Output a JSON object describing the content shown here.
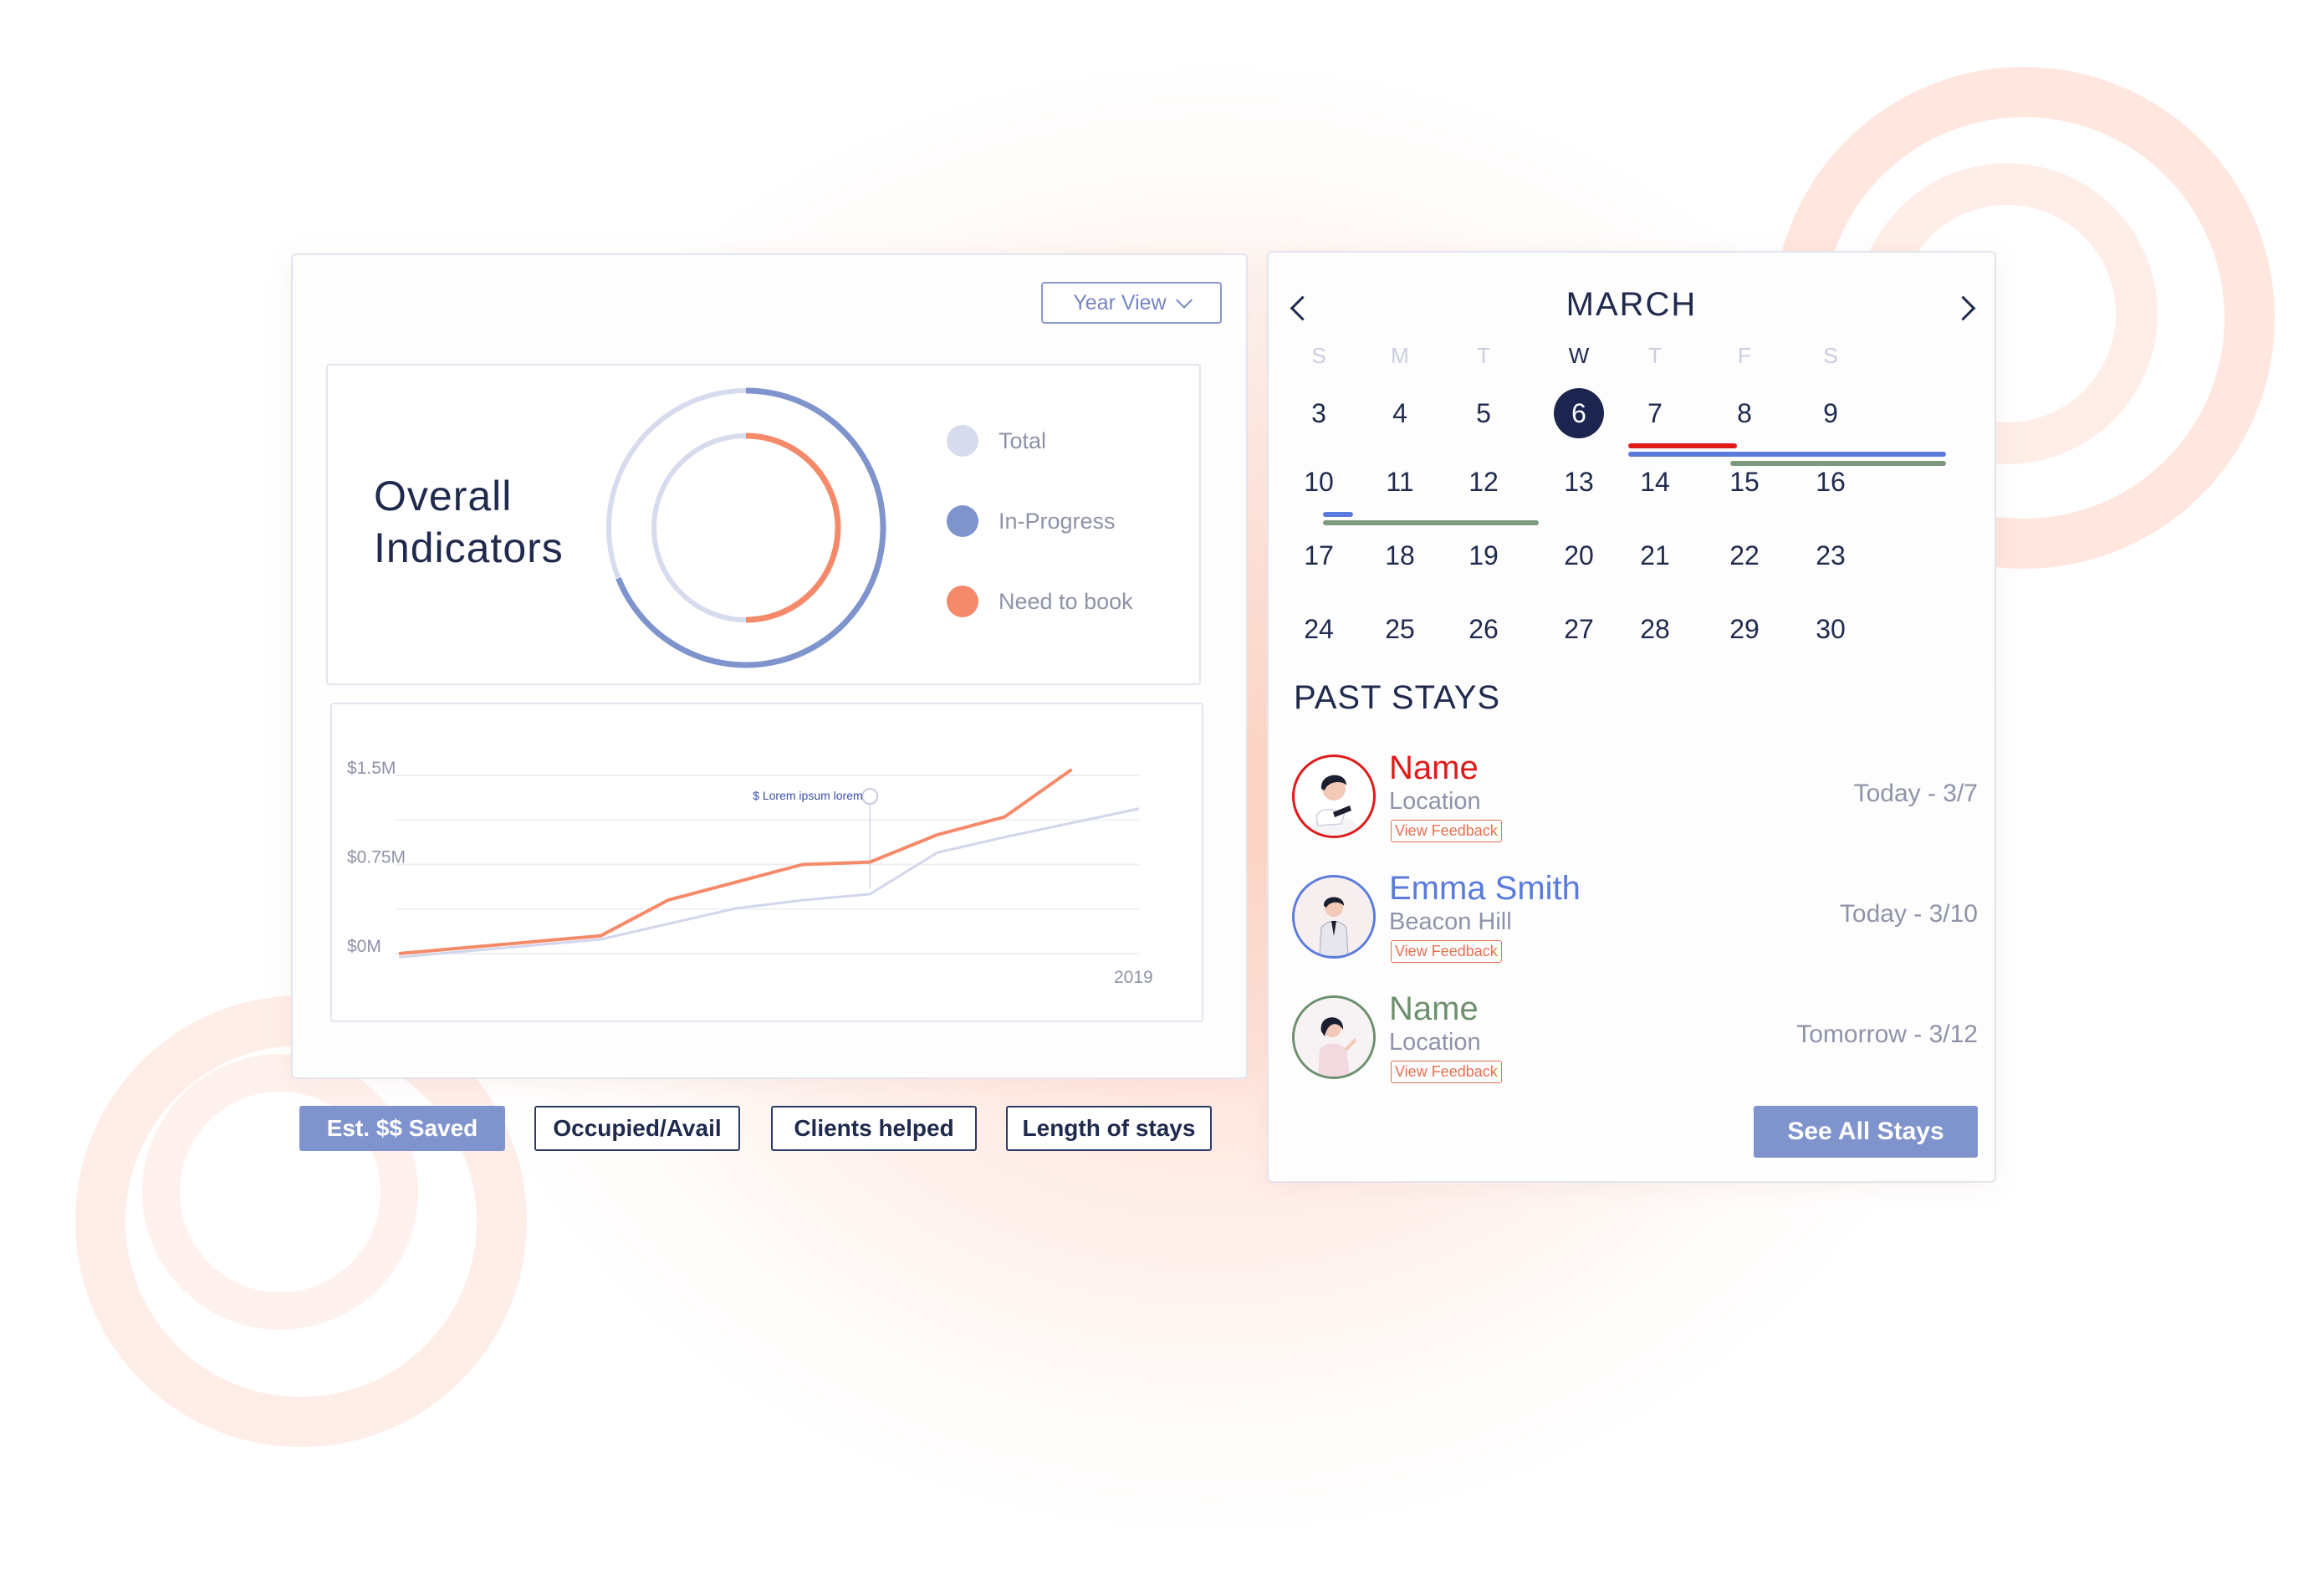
{
  "dashboard": {
    "year_view": "Year View",
    "indicators": {
      "title_line1": "Overall",
      "title_line2": "Indicators",
      "legend": [
        {
          "label": "Total",
          "color": "#d6dcee"
        },
        {
          "label": "In-Progress",
          "color": "#7f93cd"
        },
        {
          "label": "Need to book",
          "color": "#f58a6a"
        }
      ],
      "donut": {
        "outer_fraction": 0.69,
        "inner_fraction": 0.5
      }
    },
    "tabs": [
      {
        "label": "Est. $$ Saved",
        "active": true
      },
      {
        "label": "Occupied/Avail",
        "active": false
      },
      {
        "label": "Clients helped",
        "active": false
      },
      {
        "label": "Length of stays",
        "active": false
      }
    ]
  },
  "chart_data": {
    "type": "line",
    "ytick_labels": [
      "$1.5M",
      "$0.75M",
      "$0M"
    ],
    "yticks": [
      1.5,
      0.75,
      0
    ],
    "ylim": [
      0,
      1.5
    ],
    "x": [
      0,
      1,
      2,
      3,
      4,
      5,
      6,
      7,
      8,
      9,
      10,
      11
    ],
    "x_label_right": "2019",
    "annotation": "$ Lorem ipsum lorem",
    "series": [
      {
        "color": "#f58a6a",
        "values": [
          0.0,
          0.05,
          0.1,
          0.15,
          0.45,
          0.6,
          0.75,
          0.77,
          1.0,
          1.15,
          1.55,
          null
        ]
      },
      {
        "color": "#d2d6ea",
        "values": [
          -0.03,
          0.02,
          0.07,
          0.12,
          0.25,
          0.38,
          0.45,
          0.5,
          0.85,
          0.98,
          1.1,
          1.22
        ]
      }
    ],
    "grid": true
  },
  "calendar": {
    "month": "MARCH",
    "weekdays": [
      "S",
      "M",
      "T",
      "W",
      "T",
      "F",
      "S"
    ],
    "active_weekday_index": 3,
    "weeks": [
      [
        "3",
        "4",
        "5",
        "6",
        "7",
        "8",
        "9"
      ],
      [
        "10",
        "11",
        "12",
        "13",
        "14",
        "15",
        "16"
      ],
      [
        "17",
        "18",
        "19",
        "20",
        "21",
        "22",
        "23"
      ],
      [
        "24",
        "25",
        "26",
        "27",
        "28",
        "29",
        "30"
      ]
    ],
    "selected_day": "6",
    "bar_colors": {
      "red": "#e01a1a",
      "blue": "#5b7bdc",
      "green": "#7e9a7e"
    }
  },
  "past_stays": {
    "title": "PAST STAYS",
    "items": [
      {
        "name": "Name",
        "location": "Location",
        "feedback": "View Feedback",
        "date": "Today - 3/7",
        "color": "#e01a1a"
      },
      {
        "name": "Emma Smith",
        "location": "Beacon Hill",
        "feedback": "View Feedback",
        "date": "Today - 3/10",
        "color": "#5b7bdc"
      },
      {
        "name": "Name",
        "location": "Location",
        "feedback": "View Feedback",
        "date": "Tomorrow - 3/12",
        "color": "#6e8f6e"
      }
    ],
    "see_all": "See All Stays"
  }
}
